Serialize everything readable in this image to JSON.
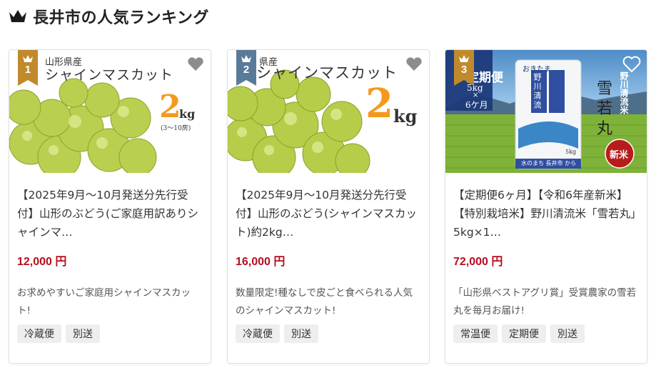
{
  "header": {
    "title": "長井市の人気ランキング"
  },
  "cards": [
    {
      "rank": "1",
      "image_text": {
        "origin": "山形県産",
        "product": "シャインマスカット",
        "weight_num": "2",
        "weight_unit": "kg",
        "period": "(3～10房)"
      },
      "title": "【2025年9月～10月発送分先行受付】山形のぶどう(ご家庭用訳ありシャインマ…",
      "price": "12,000 円",
      "description": "お求めやすいご家庭用シャインマスカット!",
      "tags": [
        "冷蔵便",
        "別送"
      ]
    },
    {
      "rank": "2",
      "image_text": {
        "origin": "県産",
        "product": "シャインマスカット",
        "weight_num": "2",
        "weight_unit": "kg"
      },
      "title": "【2025年9月～10月発送分先行受付】山形のぶどう(シャインマスカット)約2kg…",
      "price": "16,000 円",
      "description": "数量限定!種なしで皮ごと食べられる人気のシャインマスカット!",
      "tags": [
        "冷蔵便",
        "別送"
      ]
    },
    {
      "rank": "3",
      "image_text": {
        "plan": "定期便",
        "plan_detail1": "5kg",
        "plan_detail2": "×",
        "plan_detail3": "6ケ月",
        "rice_line1": "雪",
        "rice_line2": "若",
        "rice_line3": "丸",
        "brand": "野川清流米",
        "new": "新米",
        "bag_label": "野川清流",
        "bag_top": "おきたま",
        "bag_caption": "水のまち 長井市 から",
        "bag_weight": "5kg"
      },
      "title": "【定期便6ヶ月】【令和6年産新米】【特別栽培米】野川清流米「雪若丸」5kg×1…",
      "price": "72,000 円",
      "description": "「山形県ベストアグリ賞」受賞農家の雪若丸を毎月お届け!",
      "tags": [
        "常温便",
        "定期便",
        "別送"
      ]
    }
  ],
  "colors": {
    "price": "#b50e1f",
    "rank_gold": "#c08a2c",
    "rank_blue": "#5a7a9a"
  }
}
